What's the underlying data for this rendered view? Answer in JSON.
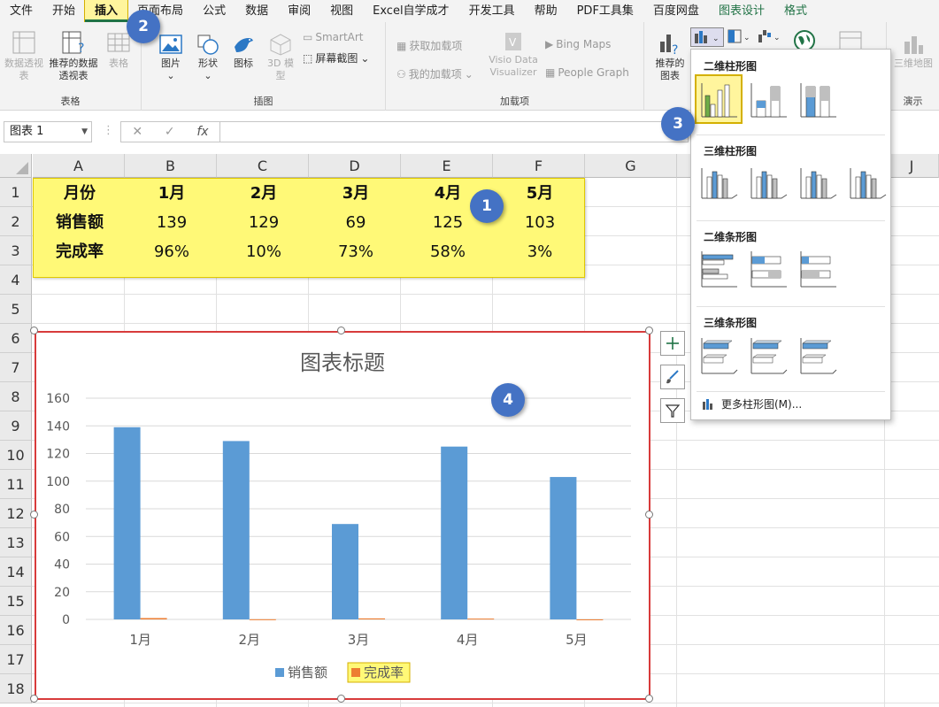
{
  "menu": {
    "tabs": [
      "文件",
      "开始",
      "插入",
      "页面布局",
      "公式",
      "数据",
      "审阅",
      "视图",
      "Excel自学成才",
      "开发工具",
      "帮助",
      "PDF工具集",
      "百度网盘",
      "图表设计",
      "格式"
    ]
  },
  "ribbon": {
    "pivot_label": "数据透视表",
    "recommended_pivot_label": "推荐的数据透视表",
    "table_label": "表格",
    "group_table": "表格",
    "picture_label": "图片",
    "shapes_label": "形状",
    "icons_label": "图标",
    "model3d_label": "3D 模型",
    "smartart_label": "SmartArt",
    "screenshot_label": "屏幕截图",
    "group_illustrations": "插图",
    "get_addins_label": "获取加载项",
    "my_addins_label": "我的加载项",
    "visio_label": "Visio Data Visualizer",
    "bing_label": "Bing Maps",
    "people_label": "People Graph",
    "group_addins": "加载项",
    "recommended_charts_label": "推荐的图表",
    "map3d_label": "三维地图",
    "group_tours": "演示"
  },
  "formula_bar": {
    "name_box": "图表 1",
    "fx": "fx",
    "value": ""
  },
  "grid": {
    "columns": [
      "A",
      "B",
      "C",
      "D",
      "E",
      "F",
      "G",
      "",
      "J"
    ],
    "rows": [
      "1",
      "2",
      "3",
      "4",
      "5",
      "6",
      "7",
      "8",
      "9",
      "10",
      "11",
      "12",
      "13",
      "14",
      "15",
      "16",
      "17",
      "18"
    ]
  },
  "table": {
    "header": [
      "月份",
      "1月",
      "2月",
      "3月",
      "4月",
      "5月"
    ],
    "sales_row": [
      "销售额",
      "139",
      "129",
      "69",
      "125",
      "103"
    ],
    "rate_row": [
      "完成率",
      "96%",
      "10%",
      "73%",
      "58%",
      "3%"
    ]
  },
  "badges": [
    "1",
    "2",
    "3",
    "4"
  ],
  "dropdown": {
    "section_2d_column": "二维柱形图",
    "section_3d_column": "三维柱形图",
    "section_2d_bar": "二维条形图",
    "section_3d_bar": "三维条形图",
    "more": "更多柱形图(M)..."
  },
  "chart_data": {
    "type": "bar",
    "title": "图表标题",
    "categories": [
      "1月",
      "2月",
      "3月",
      "4月",
      "5月"
    ],
    "series": [
      {
        "name": "销售额",
        "values": [
          139,
          129,
          69,
          125,
          103
        ],
        "color": "#5b9bd5"
      },
      {
        "name": "完成率",
        "values": [
          0.96,
          0.1,
          0.73,
          0.58,
          0.03
        ],
        "color": "#ed7d31"
      }
    ],
    "yticks": [
      "0",
      "20",
      "40",
      "60",
      "80",
      "100",
      "120",
      "140",
      "160"
    ],
    "ylim": [
      0,
      160
    ],
    "grid": true,
    "legend": "bottom"
  },
  "colors": {
    "accent": "#217346",
    "highlight": "#fff977",
    "badge": "#4472c4",
    "chart_border": "#d83b3b"
  }
}
